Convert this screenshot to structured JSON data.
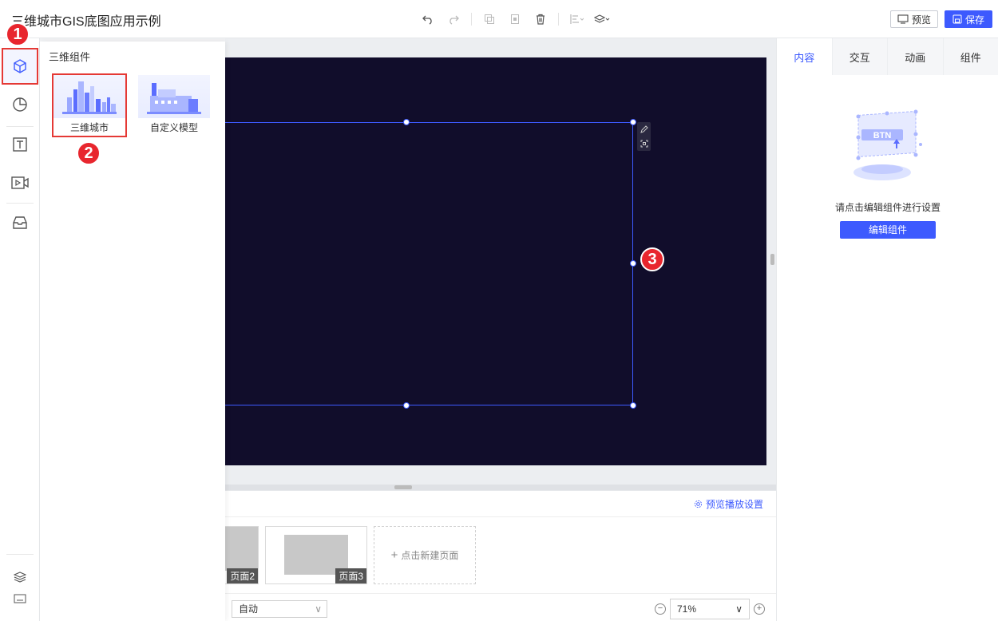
{
  "app": {
    "title": "三维城市GIS底图应用示例"
  },
  "toolbar": {
    "icons": [
      "undo-icon",
      "redo-icon",
      "copy-icon",
      "paste-icon",
      "delete-icon",
      "align-icon",
      "layer-icon"
    ],
    "preview_label": "预览",
    "save_label": "保存"
  },
  "leftbar": {
    "items": [
      "3d-cube-icon",
      "pie-chart-icon",
      "text-icon",
      "video-icon",
      "inbox-icon"
    ],
    "bottom": [
      "layers-icon",
      "keyboard-icon"
    ]
  },
  "component_panel": {
    "title": "三维组件",
    "items": [
      {
        "label": "三维城市",
        "icon": "city-skyline-icon",
        "selected": true
      },
      {
        "label": "自定义模型",
        "icon": "factory-model-icon",
        "selected": false
      }
    ]
  },
  "pages": {
    "play_settings": "预览播放设置",
    "items": [
      {
        "label": "页面2"
      },
      {
        "label": "页面3"
      }
    ],
    "new_page": "点击新建页面",
    "fit_mode": "自动",
    "zoom": "71%"
  },
  "right_panel": {
    "tabs": [
      {
        "label": "内容",
        "active": true
      },
      {
        "label": "交互",
        "active": false
      },
      {
        "label": "动画",
        "active": false
      },
      {
        "label": "组件",
        "active": false
      }
    ],
    "illustration_text": "BTN",
    "hint": "请点击编辑组件进行设置",
    "edit_button": "编辑组件"
  },
  "markers": [
    "1",
    "2",
    "3"
  ],
  "colors": {
    "accent": "#3d5afe",
    "canvas_bg": "#110d2b",
    "marker": "#e8262e"
  }
}
